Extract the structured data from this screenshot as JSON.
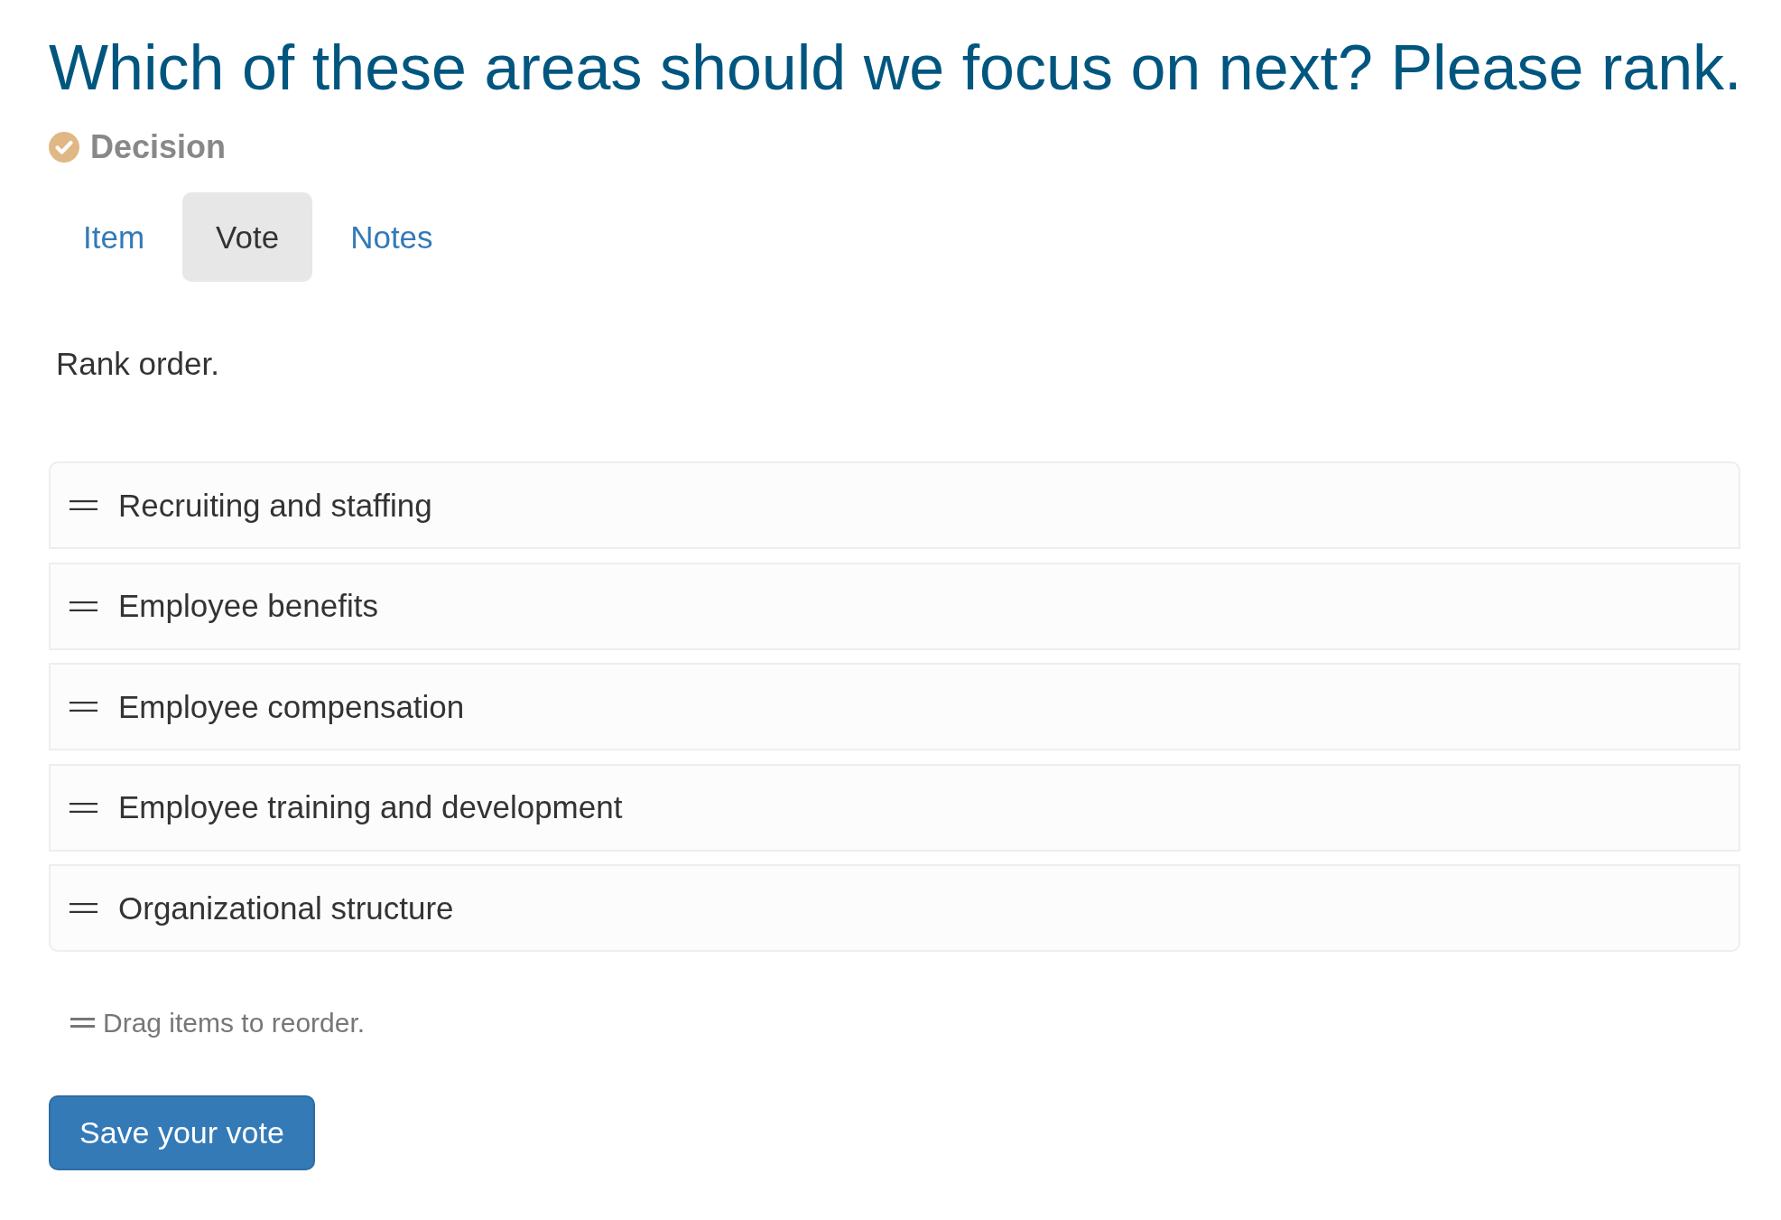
{
  "title": "Which of these areas should we focus on next? Please rank.",
  "status": {
    "label": "Decision"
  },
  "tabs": [
    {
      "label": "Item",
      "selected": false
    },
    {
      "label": "Vote",
      "selected": true
    },
    {
      "label": "Notes",
      "selected": false
    }
  ],
  "instructions": "Rank order.",
  "ranking": {
    "items": [
      {
        "label": "Recruiting and staffing"
      },
      {
        "label": "Employee benefits"
      },
      {
        "label": "Employee compensation"
      },
      {
        "label": "Employee training and development"
      },
      {
        "label": "Organizational structure"
      }
    ]
  },
  "hint": "Drag items to reorder.",
  "buttons": [
    {
      "label": "Save your vote"
    }
  ]
}
